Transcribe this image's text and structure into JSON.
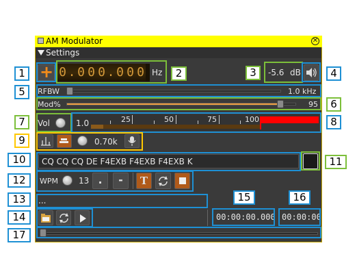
{
  "window": {
    "title": "AM Modulator",
    "settings_label": "Settings"
  },
  "frequency": {
    "digits": [
      "0",
      ".",
      "0",
      "0",
      "0",
      ".",
      "0",
      "0",
      "0"
    ],
    "unit": "Hz"
  },
  "channel_power": {
    "value": "-5.6",
    "unit": "dB"
  },
  "rfbw": {
    "label": "RFBW",
    "value": "1.0 kHz",
    "level": 0.0
  },
  "mod": {
    "label": "Mod%",
    "value": "95",
    "level": 0.95
  },
  "volume": {
    "label": "Vol",
    "meter_start": "1.0",
    "ticks": [
      "25",
      "50",
      "75",
      "100"
    ]
  },
  "tone": {
    "frequency": "0.70k"
  },
  "morse_text": {
    "value": "CQ CQ CQ DE F4EXB F4EXB F4EXB K"
  },
  "cw": {
    "wpm_label": "WPM",
    "wpm_value": "13",
    "dot": ".",
    "dash": "-",
    "text_btn": "T"
  },
  "file": {
    "name": "..."
  },
  "times": {
    "elapsed": "00:00:00.000",
    "total": "00:00:00"
  },
  "callouts": [
    "1",
    "2",
    "3",
    "4",
    "5",
    "6",
    "7",
    "8",
    "9",
    "10",
    "11",
    "12",
    "13",
    "14",
    "15",
    "16",
    "17"
  ],
  "colors": {
    "title_bar": "#ffff00",
    "callout_blue": "#1e90d4",
    "callout_green": "#7cbf3a",
    "callout_yellow": "#ffc800",
    "peak_red": "#ff0000"
  }
}
